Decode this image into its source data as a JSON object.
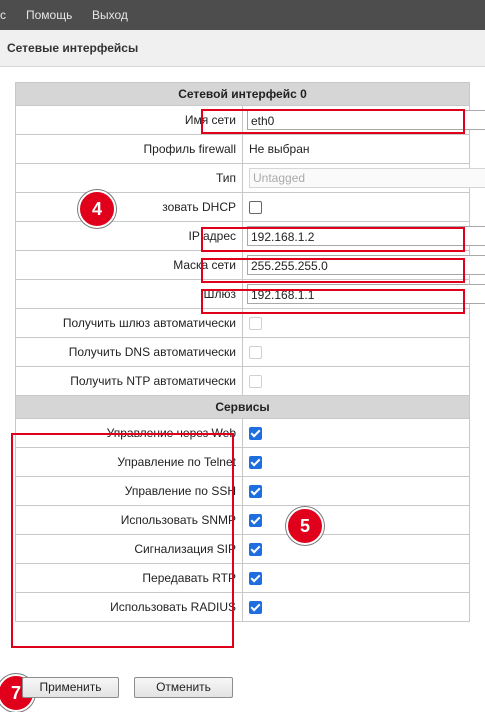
{
  "menu": {
    "items": [
      "с",
      "Помощь",
      "Выход"
    ]
  },
  "page": {
    "title": "Сетевые интерфейсы"
  },
  "interface": {
    "header": "Сетевой интерфейс 0",
    "name_label": "Имя сети",
    "name_value": "eth0",
    "firewall_label": "Профиль firewall",
    "firewall_value": "Не выбран",
    "type_label": "Тип",
    "type_value": "Untagged",
    "dhcp_label": "зовать DHCP",
    "ip_label": "IP адрес",
    "ip_value": "192.168.1.2",
    "mask_label": "Маска сети",
    "mask_value": "255.255.255.0",
    "gateway_label": "Шлюз",
    "gateway_value": "192.168.1.1",
    "auto_gw_label": "Получить шлюз автоматически",
    "auto_dns_label": "Получить DNS автоматически",
    "auto_ntp_label": "Получить NTP автоматически"
  },
  "services": {
    "header": "Сервисы",
    "items": [
      {
        "label": "Управление через Web",
        "checked": true
      },
      {
        "label": "Управление по Telnet",
        "checked": true
      },
      {
        "label": "Управление по SSH",
        "checked": true
      },
      {
        "label": "Использовать SNMP",
        "checked": true
      },
      {
        "label": "Сигнализация SIP",
        "checked": true
      },
      {
        "label": "Передавать RTP",
        "checked": true
      },
      {
        "label": "Использовать RADIUS",
        "checked": true
      }
    ]
  },
  "buttons": {
    "apply": "Применить",
    "cancel": "Отменить"
  },
  "badges": {
    "b4": "4",
    "b5": "5",
    "b7": "7"
  },
  "colors": {
    "topbar": "#4d4d4d",
    "highlight": "#e0001b",
    "checkbox": "#1f6ee0"
  }
}
